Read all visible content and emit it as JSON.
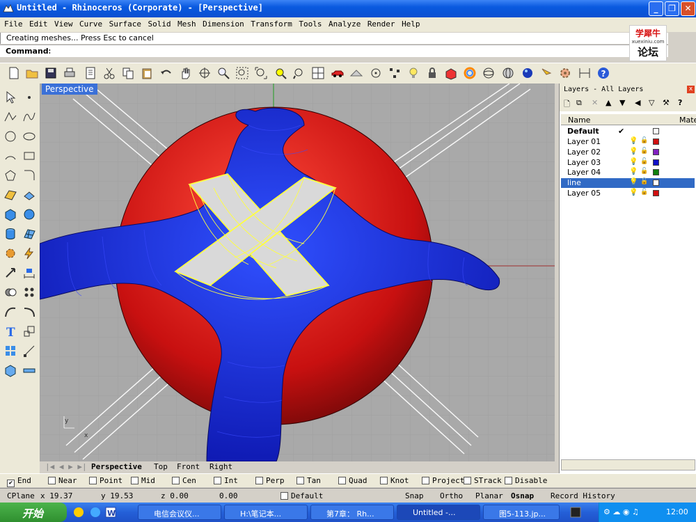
{
  "titlebar": {
    "title": "Untitled - Rhinoceros (Corporate) - [Perspective]",
    "minimize": "_",
    "restore": "❐",
    "close": "✕"
  },
  "menu": [
    "File",
    "Edit",
    "View",
    "Curve",
    "Surface",
    "Solid",
    "Mesh",
    "Dimension",
    "Transform",
    "Tools",
    "Analyze",
    "Render",
    "Help"
  ],
  "command": {
    "history": "Creating meshes... Press Esc to cancel",
    "label": "Command:",
    "value": ""
  },
  "logo": {
    "top": "学犀牛",
    "mid": "xuexiniu.com",
    "bottom": "论坛"
  },
  "viewport": {
    "label": "Perspective"
  },
  "view_tabs": [
    "Perspective",
    "Top",
    "Front",
    "Right"
  ],
  "layers": {
    "title": "Layers - All Layers",
    "close": "x",
    "header_name": "Name",
    "header_material": "Mate",
    "rows": [
      {
        "name": "Default",
        "current": "✔",
        "color": "#ffffff"
      },
      {
        "name": "Layer 01",
        "color": "#d01010"
      },
      {
        "name": "Layer 02",
        "color": "#8020c0"
      },
      {
        "name": "Layer 03",
        "color": "#1010c8"
      },
      {
        "name": "Layer 04",
        "color": "#108010"
      },
      {
        "name": "line",
        "color": "#ffffff",
        "selected": true
      },
      {
        "name": "Layer 05",
        "color": "#d01010"
      }
    ]
  },
  "osnap": [
    {
      "label": "End",
      "checked": true
    },
    {
      "label": "Near",
      "checked": false
    },
    {
      "label": "Point",
      "checked": false
    },
    {
      "label": "Mid",
      "checked": false
    },
    {
      "label": "Cen",
      "checked": false
    },
    {
      "label": "Int",
      "checked": false
    },
    {
      "label": "Perp",
      "checked": false
    },
    {
      "label": "Tan",
      "checked": false
    },
    {
      "label": "Quad",
      "checked": false
    },
    {
      "label": "Knot",
      "checked": false
    },
    {
      "label": "Project",
      "checked": false
    },
    {
      "label": "STrack",
      "checked": false
    },
    {
      "label": "Disable",
      "checked": false
    }
  ],
  "status": {
    "cplane": "CPlane",
    "x": "x 19.37",
    "y": "y 19.53",
    "z": "z 0.00",
    "d": "0.00",
    "layer": "Default",
    "snap": "Snap",
    "ortho": "Ortho",
    "planar": "Planar",
    "osnap": "Osnap",
    "history": "Record History"
  },
  "taskbar": {
    "start": "开始",
    "tasks": [
      "电信会议仪...",
      "H:\\笔记本...",
      "第7章： Rh...",
      "Untitled -...",
      "图5-113.jp..."
    ],
    "clock": "12:00"
  },
  "colors": {
    "title_blue": "#0a5ae0",
    "surface_blue": "#1a2ad8",
    "sphere_red": "#d01010",
    "wire_yellow": "#ffff40",
    "selected_row": "#316ac5"
  }
}
